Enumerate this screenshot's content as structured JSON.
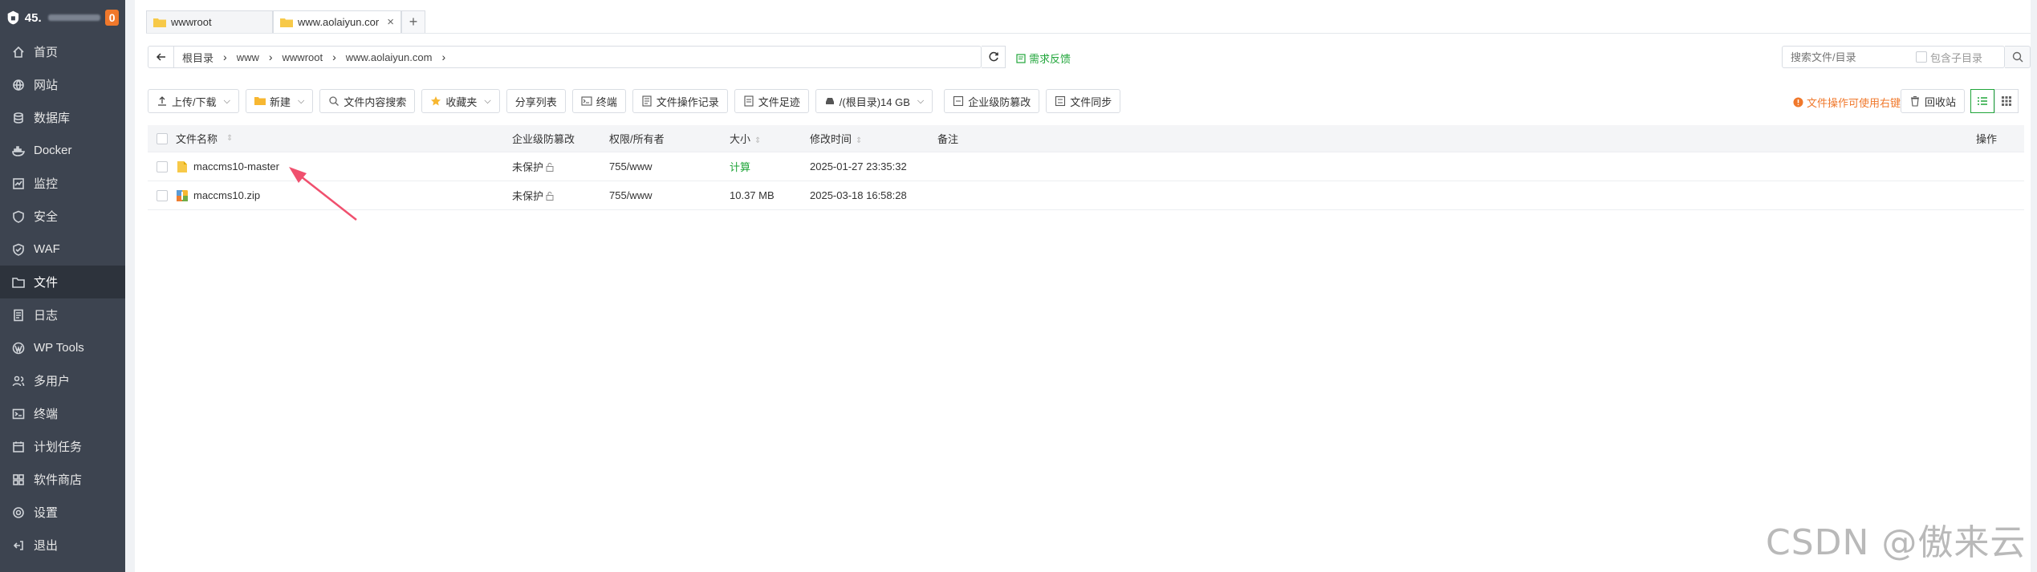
{
  "sidebar": {
    "ip_prefix": "45.",
    "badge": "0",
    "items": [
      {
        "label": "首页",
        "icon": "home-icon"
      },
      {
        "label": "网站",
        "icon": "globe-icon"
      },
      {
        "label": "数据库",
        "icon": "database-icon"
      },
      {
        "label": "Docker",
        "icon": "docker-icon"
      },
      {
        "label": "监控",
        "icon": "monitor-icon"
      },
      {
        "label": "安全",
        "icon": "shield-icon"
      },
      {
        "label": "WAF",
        "icon": "waf-shield-icon"
      },
      {
        "label": "文件",
        "icon": "folder-icon",
        "active": true
      },
      {
        "label": "日志",
        "icon": "log-icon"
      },
      {
        "label": "WP Tools",
        "icon": "wordpress-icon"
      },
      {
        "label": "多用户",
        "icon": "users-icon"
      },
      {
        "label": "终端",
        "icon": "terminal-icon"
      },
      {
        "label": "计划任务",
        "icon": "calendar-icon"
      },
      {
        "label": "软件商店",
        "icon": "store-icon"
      },
      {
        "label": "设置",
        "icon": "gear-icon"
      },
      {
        "label": "退出",
        "icon": "logout-icon"
      }
    ]
  },
  "tabs": [
    {
      "label": "wwwroot"
    },
    {
      "label": "www.aolaiyun.cor"
    }
  ],
  "address": {
    "crumbs": [
      "根目录",
      "www",
      "wwwroot",
      "www.aolaiyun.com"
    ],
    "feedback": "需求反馈"
  },
  "search": {
    "placeholder": "搜索文件/目录",
    "subdir_label": "包含子目录"
  },
  "toolbar": {
    "upload": "上传/下载",
    "new": "新建",
    "content_search": "文件内容搜索",
    "favorites": "收藏夹",
    "share_list": "分享列表",
    "terminal": "终端",
    "op_log": "文件操作记录",
    "footprint": "文件足迹",
    "disk": "/(根目录)14 GB",
    "tamper": "企业级防篡改",
    "sync": "文件同步",
    "tip": "文件操作可使用右键",
    "recycle": "回收站"
  },
  "table": {
    "headers": {
      "name": "文件名称",
      "protect": "企业级防篡改",
      "perm": "权限/所有者",
      "size": "大小",
      "mtime": "修改时间",
      "note": "备注",
      "op": "操作"
    },
    "rows": [
      {
        "name": "maccms10-master",
        "type": "folder",
        "protect": "未保护",
        "perm": "755/www",
        "size": "计算",
        "mtime": "2025-01-27 23:35:32",
        "note": ""
      },
      {
        "name": "maccms10.zip",
        "type": "zip",
        "protect": "未保护",
        "perm": "755/www",
        "size": "10.37 MB",
        "mtime": "2025-03-18 16:58:28",
        "note": ""
      }
    ]
  },
  "watermark": "CSDN @傲来云",
  "colors": {
    "accent": "#20a53a",
    "sidebar": "#3d4450",
    "warning": "#f0782b",
    "arrow": "#f0506e"
  }
}
